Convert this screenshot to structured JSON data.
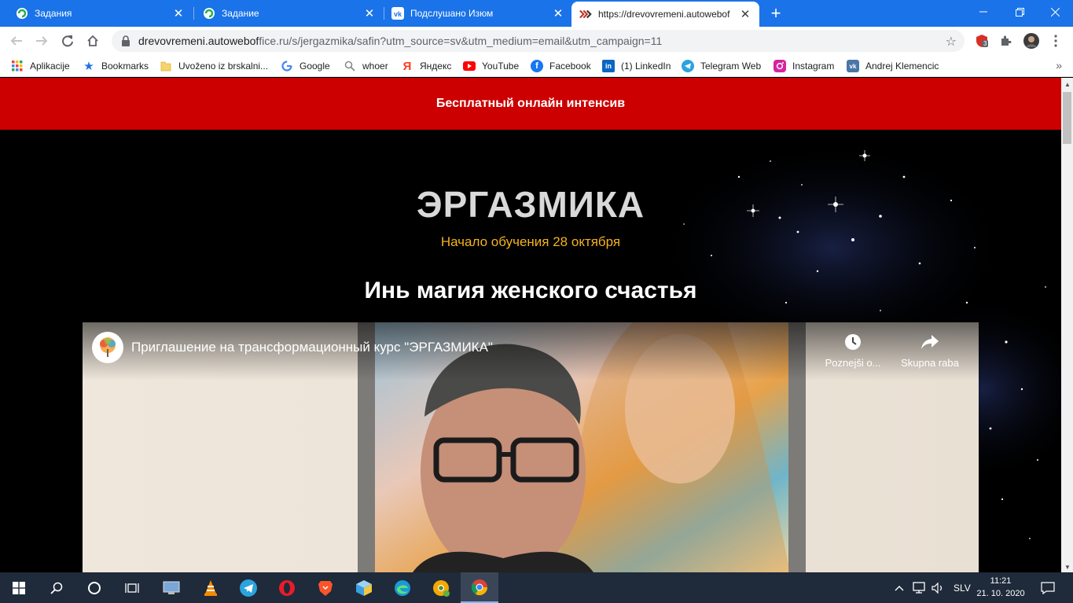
{
  "browser": {
    "tabs": [
      {
        "title": "Задания",
        "active": false
      },
      {
        "title": "Задание",
        "active": false
      },
      {
        "title": "Подслушано Изюм",
        "active": false
      },
      {
        "title": "https://drevovremeni.autowebof",
        "active": true
      }
    ],
    "url_host": "drevovremeni.autowebof",
    "url_rest": "fice.ru/s/jergazmika/safin?utm_source=sv&utm_medium=email&utm_campaign=11",
    "extension_badge": "3",
    "bookmarks": [
      {
        "label": "Aplikacije",
        "icon": "apps-grid-icon"
      },
      {
        "label": "Bookmarks",
        "icon": "star-icon"
      },
      {
        "label": "Uvoženo iz brskalni...",
        "icon": "folder-icon"
      },
      {
        "label": "Google",
        "icon": "google-icon"
      },
      {
        "label": "whoer",
        "icon": "search-icon"
      },
      {
        "label": "Яндекс",
        "icon": "yandex-icon"
      },
      {
        "label": "YouTube",
        "icon": "youtube-icon"
      },
      {
        "label": "Facebook",
        "icon": "facebook-icon"
      },
      {
        "label": "(1) LinkedIn",
        "icon": "linkedin-icon"
      },
      {
        "label": "Telegram Web",
        "icon": "telegram-icon"
      },
      {
        "label": "Instagram",
        "icon": "instagram-icon"
      },
      {
        "label": "Andrej Klemencic",
        "icon": "vk-icon"
      }
    ]
  },
  "page": {
    "banner": "Бесплатный онлайн интенсив",
    "brand": "ЭРГАЗМИКА",
    "start_date": "Начало обучения 28 октября",
    "subtitle": "Инь магия женского счастья",
    "video": {
      "title": "Приглашение на трансформационный курс \"ЭРГАЗМИКА\"",
      "watch_later": "Poznejši o...",
      "share": "Skupna raba"
    }
  },
  "taskbar": {
    "language": "SLV",
    "time": "11:21",
    "date": "21. 10. 2020"
  },
  "colors": {
    "chrome_blue": "#1a73e8",
    "banner_red": "#cc0000",
    "date_yellow": "#f5b21b",
    "taskbar": "#1f2a3a"
  }
}
